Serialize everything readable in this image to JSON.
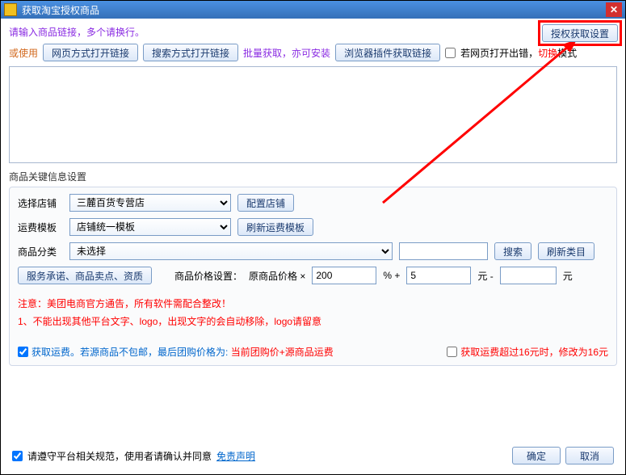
{
  "titlebar": {
    "title": "获取淘宝授权商品"
  },
  "hint": "请输入商品链接，多个请换行。",
  "authBtn": "授权获取设置",
  "row2": {
    "orUse": "或使用",
    "openWeb": "网页方式打开链接",
    "openSearch": "搜索方式打开链接",
    "batch": "批量获取，亦可安装",
    "plugin": "浏览器插件获取链接",
    "errSwitch": "若网页打开出错，",
    "errSwitch2": "切换",
    "errSwitch3": "模式"
  },
  "keyInfo": "商品关键信息设置",
  "shop": {
    "label": "选择店铺",
    "value": "三麓百货专营店",
    "configBtn": "配置店铺"
  },
  "tpl": {
    "label": "运费模板",
    "value": "店铺统一模板",
    "refreshBtn": "刷新运费模板"
  },
  "cat": {
    "label": "商品分类",
    "value": "未选择",
    "searchBtn": "搜索",
    "refreshBtn": "刷新类目"
  },
  "promise": "服务承诺、商品卖点、资质",
  "price": {
    "label": "商品价格设置：",
    "formula1": "原商品价格 ×",
    "val1": "200",
    "pct": "% +",
    "val2": "5",
    "yuan1": "元 -",
    "yuan2": "元"
  },
  "notice1": "注意：美团电商官方通告，所有软件需配合整改！",
  "notice2": "1、不能出现其他平台文字、logo，出现文字的会自动移除，logo请留意",
  "ship": {
    "chk1a": "获取运费。",
    "chk1b": "若源商品不包邮，最后团购价格为:",
    "chk1c": "当前团购价+源商品运费",
    "chk2": "获取运费超过16元时，修改为16元"
  },
  "footer": {
    "agree": "请遵守平台相关规范，使用者请确认并同意",
    "disclaimer": "免责声明",
    "ok": "确定",
    "cancel": "取消"
  }
}
